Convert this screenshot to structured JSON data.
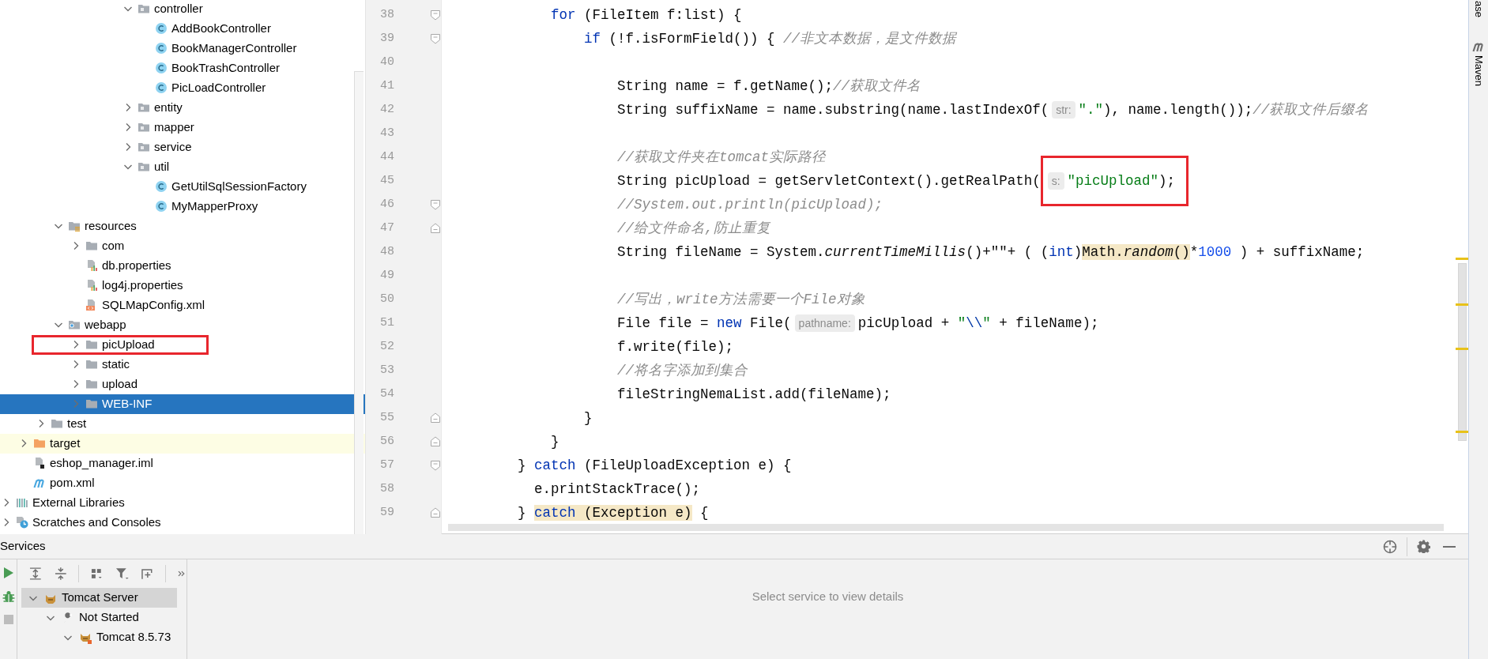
{
  "project_tree": {
    "items": [
      {
        "children": [
          {
            "children": [
              {
                "children": [
                  {
                    "children": [
                      {
                        "children": [
                          {
                            "children": [
                              {
                                "children": [
                                  {
                                    "label": "controller",
                                    "kind": "package",
                                    "expanded": true,
                                    "selected": false,
                                    "annotated": false,
                                    "children": [
                                      {
                                        "label": "AddBookController",
                                        "kind": "class",
                                        "selected": false,
                                        "annotated": false
                                      },
                                      {
                                        "label": "BookManagerController",
                                        "kind": "class",
                                        "selected": false,
                                        "annotated": false
                                      },
                                      {
                                        "label": "BookTrashController",
                                        "kind": "class",
                                        "selected": false,
                                        "annotated": false
                                      },
                                      {
                                        "label": "PicLoadController",
                                        "kind": "class",
                                        "selected": false,
                                        "annotated": false
                                      }
                                    ]
                                  },
                                  {
                                    "label": "entity",
                                    "kind": "package",
                                    "expanded": false,
                                    "selected": false,
                                    "annotated": false
                                  },
                                  {
                                    "label": "mapper",
                                    "kind": "package",
                                    "expanded": false,
                                    "selected": false,
                                    "annotated": false
                                  },
                                  {
                                    "label": "service",
                                    "kind": "package",
                                    "expanded": false,
                                    "selected": false,
                                    "annotated": false
                                  },
                                  {
                                    "label": "util",
                                    "kind": "package",
                                    "expanded": true,
                                    "selected": false,
                                    "annotated": false,
                                    "children": [
                                      {
                                        "label": "GetUtilSqlSessionFactory",
                                        "kind": "class",
                                        "selected": false,
                                        "annotated": false
                                      },
                                      {
                                        "label": "MyMapperProxy",
                                        "kind": "class",
                                        "selected": false,
                                        "annotated": false
                                      }
                                    ]
                                  }
                                ]
                              }
                            ]
                          }
                        ]
                      }
                    ]
                  },
                  {
                    "label": "resources",
                    "kind": "resources-folder",
                    "expanded": true,
                    "selected": false,
                    "annotated": false,
                    "children": [
                      {
                        "label": "com",
                        "kind": "folder",
                        "expanded": false,
                        "selected": false,
                        "annotated": false
                      },
                      {
                        "label": "db.properties",
                        "kind": "properties",
                        "selected": false,
                        "annotated": false
                      },
                      {
                        "label": "log4j.properties",
                        "kind": "properties",
                        "selected": false,
                        "annotated": false
                      },
                      {
                        "label": "SQLMapConfig.xml",
                        "kind": "xml",
                        "selected": false,
                        "annotated": false
                      }
                    ]
                  },
                  {
                    "label": "webapp",
                    "kind": "webapp-folder",
                    "expanded": true,
                    "selected": false,
                    "annotated": false,
                    "children": [
                      {
                        "label": "picUpload",
                        "kind": "folder",
                        "expanded": false,
                        "selected": false,
                        "annotated": true
                      },
                      {
                        "label": "static",
                        "kind": "folder",
                        "expanded": false,
                        "selected": false,
                        "annotated": false
                      },
                      {
                        "label": "upload",
                        "kind": "folder",
                        "expanded": false,
                        "selected": false,
                        "annotated": false
                      },
                      {
                        "label": "WEB-INF",
                        "kind": "folder",
                        "expanded": false,
                        "selected": true,
                        "annotated": false
                      }
                    ]
                  }
                ]
              },
              {
                "label": "test",
                "kind": "folder",
                "expanded": false,
                "selected": false,
                "annotated": false
              }
            ]
          },
          {
            "label": "target",
            "kind": "excluded-folder",
            "expanded": false,
            "selected": false,
            "annotated": false
          },
          {
            "label": "eshop_manager.iml",
            "kind": "iml",
            "selected": false,
            "annotated": false
          },
          {
            "label": "pom.xml",
            "kind": "maven",
            "selected": false,
            "annotated": false
          }
        ]
      },
      {
        "label": "External Libraries",
        "kind": "libraries",
        "expanded": false,
        "selected": false,
        "annotated": false
      },
      {
        "label": "Scratches and Consoles",
        "kind": "scratches",
        "expanded": false,
        "selected": false,
        "annotated": false
      }
    ]
  },
  "editor": {
    "lines": [
      {
        "number": "38",
        "kind": "fold-start",
        "segments": [
          {
            "kind": "keyword",
            "text": "            for"
          },
          {
            "kind": "plain",
            "text": " (FileItem f:list) {"
          }
        ]
      },
      {
        "number": "39",
        "kind": "fold-start",
        "segments": [
          {
            "kind": "keyword",
            "text": "                if"
          },
          {
            "kind": "plain",
            "text": " (!f.isFormField()) { "
          },
          {
            "kind": "comment",
            "text": "//非文本数据，是文件数据"
          }
        ]
      },
      {
        "number": "40",
        "kind": "plain"
      },
      {
        "number": "41",
        "kind": "plain",
        "segments": [
          {
            "kind": "plain",
            "text": "                    String name = f.getName();"
          },
          {
            "kind": "comment",
            "text": "//获取文件名"
          }
        ]
      },
      {
        "number": "42",
        "kind": "plain",
        "segments": [
          {
            "kind": "plain",
            "text": "                    String suffixName = name.substring(name.lastIndexOf("
          },
          {
            "kind": "hint",
            "text": "str:"
          },
          {
            "kind": "string",
            "text": "\".\""
          },
          {
            "kind": "plain",
            "text": "), name.length());"
          },
          {
            "kind": "comment",
            "text": "//获取文件后缀名"
          }
        ]
      },
      {
        "number": "43",
        "kind": "plain"
      },
      {
        "number": "44",
        "kind": "plain",
        "segments": [
          {
            "kind": "comment",
            "text": "                    //获取文件夹在tomcat实际路径"
          }
        ]
      },
      {
        "number": "45",
        "kind": "plain",
        "segments": [
          {
            "kind": "plain",
            "text": "                    String picUpload = getServletContext().getRealPath("
          },
          {
            "kind": "hint",
            "text": "s:",
            "annotated": true
          },
          {
            "kind": "string",
            "text": "\"picUpload\"",
            "annotated": true
          },
          {
            "kind": "plain",
            "text": ");",
            "annotated": true
          }
        ]
      },
      {
        "number": "46",
        "kind": "fold-start",
        "segments": [
          {
            "kind": "comment",
            "text": "                    //System.out.println(picUpload);"
          }
        ]
      },
      {
        "number": "47",
        "kind": "fold-end",
        "segments": [
          {
            "kind": "comment",
            "text": "                    //给文件命名,防止重复"
          }
        ]
      },
      {
        "number": "48",
        "kind": "plain",
        "segments": [
          {
            "kind": "plain",
            "text": "                    String fileName = System."
          },
          {
            "kind": "italic",
            "text": "currentTimeMillis"
          },
          {
            "kind": "plain",
            "text": "()+\"\"+ ( ("
          },
          {
            "kind": "keyword",
            "text": "int"
          },
          {
            "kind": "plain",
            "text": ")"
          },
          {
            "kind": "match",
            "text": "Math."
          },
          {
            "kind": "match-italic",
            "text": "random"
          },
          {
            "kind": "match",
            "text": "()"
          },
          {
            "kind": "plain",
            "text": "*"
          },
          {
            "kind": "number",
            "text": "1000"
          },
          {
            "kind": "plain",
            "text": " ) + suffixName;"
          }
        ]
      },
      {
        "number": "49",
        "kind": "plain"
      },
      {
        "number": "50",
        "kind": "plain",
        "segments": [
          {
            "kind": "comment",
            "text": "                    //写出，write方法需要一个File对象"
          }
        ]
      },
      {
        "number": "51",
        "kind": "plain",
        "segments": [
          {
            "kind": "plain",
            "text": "                    File file = "
          },
          {
            "kind": "keyword",
            "text": "new"
          },
          {
            "kind": "plain",
            "text": " File("
          },
          {
            "kind": "hint",
            "text": "pathname:"
          },
          {
            "kind": "plain",
            "text": "picUpload + "
          },
          {
            "kind": "string",
            "text": "\""
          },
          {
            "kind": "escape",
            "text": "\\\\"
          },
          {
            "kind": "string",
            "text": "\""
          },
          {
            "kind": "plain",
            "text": " + fileName);"
          }
        ]
      },
      {
        "number": "52",
        "kind": "plain",
        "segments": [
          {
            "kind": "plain",
            "text": "                    f.write(file);"
          }
        ]
      },
      {
        "number": "53",
        "kind": "plain",
        "segments": [
          {
            "kind": "comment",
            "text": "                    //将名字添加到集合"
          }
        ]
      },
      {
        "number": "54",
        "kind": "plain",
        "segments": [
          {
            "kind": "plain",
            "text": "                    fileStringNemaList.add(fileName);"
          }
        ]
      },
      {
        "number": "55",
        "kind": "fold-end",
        "segments": [
          {
            "kind": "plain",
            "text": "                }"
          }
        ]
      },
      {
        "number": "56",
        "kind": "fold-end",
        "segments": [
          {
            "kind": "plain",
            "text": "            }"
          }
        ]
      },
      {
        "number": "57",
        "kind": "fold-start",
        "segments": [
          {
            "kind": "plain",
            "text": "        } "
          },
          {
            "kind": "keyword",
            "text": "catch"
          },
          {
            "kind": "plain",
            "text": " (FileUploadException e) {"
          }
        ]
      },
      {
        "number": "58",
        "kind": "plain",
        "segments": [
          {
            "kind": "plain",
            "text": "          e.printStackTrace();"
          }
        ]
      },
      {
        "number": "59",
        "kind": "fold-end",
        "segments": [
          {
            "kind": "plain",
            "text": "        } "
          },
          {
            "kind": "match-keyword",
            "text": "catch"
          },
          {
            "kind": "match",
            "text": " (Exception e)"
          },
          {
            "kind": "plain",
            "text": " {"
          }
        ]
      }
    ]
  },
  "tool_strip": [
    {
      "label": "ase",
      "kind": "plain"
    },
    {
      "label": "Maven",
      "kind": "maven"
    }
  ],
  "services": {
    "title": "Services",
    "tree": [
      {
        "label": "Tomcat Server",
        "kind": "server",
        "expanded": true,
        "selected": true,
        "children": [
          {
            "label": "Not Started",
            "kind": "status",
            "expanded": true,
            "selected": false,
            "children": [
              {
                "label": "Tomcat 8.5.73",
                "kind": "instance",
                "expanded": true,
                "selected": false
              }
            ]
          }
        ]
      }
    ],
    "empty_message": "Select service to view details"
  }
}
